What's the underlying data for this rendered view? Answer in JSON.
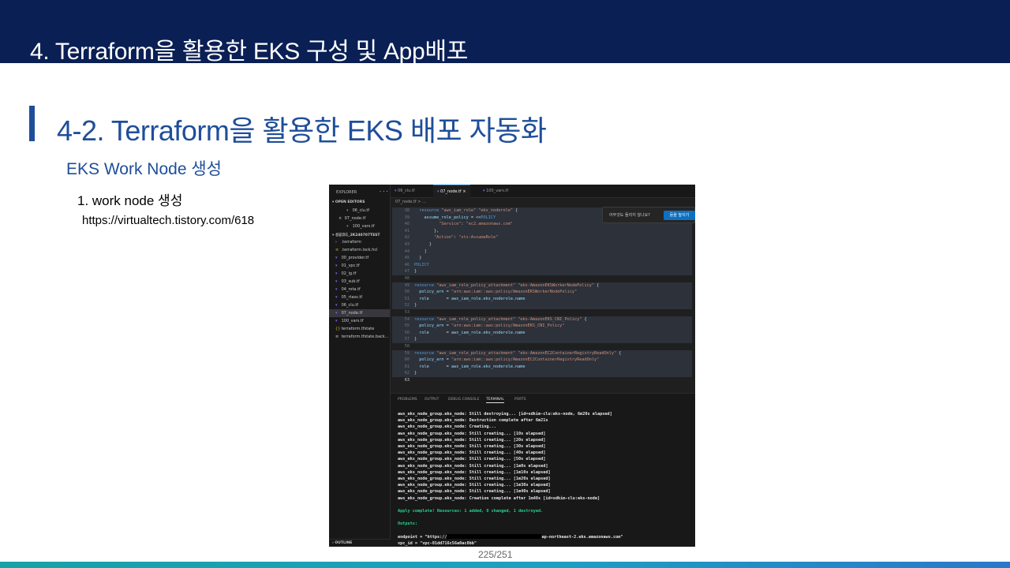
{
  "header": {
    "title": "4. Terraform을 활용한 EKS 구성 및 App배포"
  },
  "section": {
    "title": "4-2. Terraform을 활용한 EKS 배포 자동화",
    "subtitle": "EKS Work Node 생성",
    "step": "1. work node 생성",
    "url": "https://virtualtech.tistory.com/618"
  },
  "footer": {
    "page": "225/251"
  },
  "colors": {
    "header_band": "#0a1f54",
    "accent_blue": "#1f4e9a",
    "bottom_band_start": "#15a3a6",
    "bottom_band_end": "#2b78c9"
  },
  "ide": {
    "explorer": {
      "title": "EXPLORER",
      "more": "···",
      "open_editors_label": "OPEN EDITORS",
      "open_editors": [
        {
          "icon": "terraform-icon",
          "name": "06_clu.tf"
        },
        {
          "icon": "close-icon",
          "name": "07_node.tf"
        },
        {
          "icon": "terraform-icon",
          "name": "100_vars.tf"
        }
      ],
      "project_label": "성공코드_2K240707TEST",
      "files": [
        {
          "icon": "chevron-right-icon",
          "name": ".terraform"
        },
        {
          "icon": "lock-icon",
          "name": ".terraform.lock.hcl"
        },
        {
          "icon": "terraform-icon",
          "name": "00_provider.tf"
        },
        {
          "icon": "terraform-icon",
          "name": "01_vpc.tf"
        },
        {
          "icon": "terraform-icon",
          "name": "02_ig.tf"
        },
        {
          "icon": "terraform-icon",
          "name": "03_sub.tf"
        },
        {
          "icon": "terraform-icon",
          "name": "04_rota.tf"
        },
        {
          "icon": "terraform-icon",
          "name": "05_rtass.tf"
        },
        {
          "icon": "terraform-icon",
          "name": "06_clu.tf"
        },
        {
          "icon": "terraform-icon",
          "name": "07_node.tf"
        },
        {
          "icon": "terraform-icon",
          "name": "100_vars.tf"
        },
        {
          "icon": "braces-icon",
          "name": "terraform.tfstate"
        },
        {
          "icon": "state-icon",
          "name": "terraform.tfstate.back..."
        }
      ],
      "active_file": "07_node.tf",
      "outline_label": "OUTLINE"
    },
    "tabs": [
      {
        "name": "06_clu.tf",
        "active": false
      },
      {
        "name": "07_node.tf",
        "active": true,
        "close": "×"
      },
      {
        "name": "100_vars.tf",
        "active": false
      }
    ],
    "breadcrumb": "07_node.tf > ...",
    "popup": {
      "text": "아무것도 들리지 않나요?",
      "button": "듣을 높이기"
    },
    "code_lines": [
      {
        "n": "38",
        "t": "  resource \"aws_iam_role\" \"eks_noderole\" {",
        "hl": true
      },
      {
        "n": "39",
        "t": "    assume_role_policy = <<POLICY",
        "hl": true
      },
      {
        "n": "40",
        "t": "          \"Service\": \"ec2.amazonaws.com\"",
        "hl": true
      },
      {
        "n": "41",
        "t": "        },",
        "hl": true
      },
      {
        "n": "42",
        "t": "        \"Action\": \"sts:AssumeRole\"",
        "hl": true
      },
      {
        "n": "43",
        "t": "      }",
        "hl": true
      },
      {
        "n": "44",
        "t": "    ]",
        "hl": true
      },
      {
        "n": "45",
        "t": "  }",
        "hl": true
      },
      {
        "n": "46",
        "t": "POLICY",
        "hl": true
      },
      {
        "n": "47",
        "t": "}",
        "hl": true
      },
      {
        "n": "48",
        "t": "",
        "hl": false
      },
      {
        "n": "49",
        "t": "resource \"aws_iam_role_policy_attachment\" \"eks-AmazonEKSWorkerNodePolicy\" {",
        "hl": true
      },
      {
        "n": "50",
        "t": "  policy_arn = \"arn:aws:iam::aws:policy/AmazonEKSWorkerNodePolicy\"",
        "hl": true
      },
      {
        "n": "51",
        "t": "  role       = aws_iam_role.eks_noderole.name",
        "hl": true
      },
      {
        "n": "52",
        "t": "}",
        "hl": true
      },
      {
        "n": "53",
        "t": "",
        "hl": false
      },
      {
        "n": "54",
        "t": "resource \"aws_iam_role_policy_attachment\" \"eks-AmazonEKS_CNI_Policy\" {",
        "hl": true
      },
      {
        "n": "55",
        "t": "  policy_arn = \"arn:aws:iam::aws:policy/AmazonEKS_CNI_Policy\"",
        "hl": true
      },
      {
        "n": "56",
        "t": "  role       = aws_iam_role.eks_noderole.name",
        "hl": true
      },
      {
        "n": "57",
        "t": "}",
        "hl": true
      },
      {
        "n": "58",
        "t": "",
        "hl": false
      },
      {
        "n": "59",
        "t": "resource \"aws_iam_role_policy_attachment\" \"eks-AmazonEC2ContainerRegistryReadOnly\" {",
        "hl": true
      },
      {
        "n": "60",
        "t": "  policy_arn = \"arn:aws:iam::aws:policy/AmazonEC2ContainerRegistryReadOnly\"",
        "hl": true
      },
      {
        "n": "61",
        "t": "  role       = aws_iam_role.eks_noderole.name",
        "hl": true
      },
      {
        "n": "62",
        "t": "}",
        "hl": true
      },
      {
        "n": "63",
        "t": "",
        "hl": false
      }
    ],
    "panel_tabs": [
      {
        "name": "PROBLEMS",
        "active": false
      },
      {
        "name": "OUTPUT",
        "active": false
      },
      {
        "name": "DEBUG CONSOLE",
        "active": false
      },
      {
        "name": "TERMINAL",
        "active": true
      },
      {
        "name": "PORTS",
        "active": false
      }
    ],
    "terminal": [
      {
        "t": "aws_eks_node_group.eks_node: Still destroying... [id=sdkim-clu:eks-node, 6m20s elapsed]",
        "c": "white"
      },
      {
        "t": "aws_eks_node_group.eks_node: Destruction complete after 6m21s",
        "c": "white"
      },
      {
        "t": "aws_eks_node_group.eks_node: Creating...",
        "c": "white"
      },
      {
        "t": "aws_eks_node_group.eks_node: Still creating... [10s elapsed]",
        "c": "white"
      },
      {
        "t": "aws_eks_node_group.eks_node: Still creating... [20s elapsed]",
        "c": "white"
      },
      {
        "t": "aws_eks_node_group.eks_node: Still creating... [30s elapsed]",
        "c": "white"
      },
      {
        "t": "aws_eks_node_group.eks_node: Still creating... [40s elapsed]",
        "c": "white"
      },
      {
        "t": "aws_eks_node_group.eks_node: Still creating... [50s elapsed]",
        "c": "white"
      },
      {
        "t": "aws_eks_node_group.eks_node: Still creating... [1m0s elapsed]",
        "c": "white"
      },
      {
        "t": "aws_eks_node_group.eks_node: Still creating... [1m10s elapsed]",
        "c": "white"
      },
      {
        "t": "aws_eks_node_group.eks_node: Still creating... [1m20s elapsed]",
        "c": "white"
      },
      {
        "t": "aws_eks_node_group.eks_node: Still creating... [1m30s elapsed]",
        "c": "white"
      },
      {
        "t": "aws_eks_node_group.eks_node: Still creating... [1m40s elapsed]",
        "c": "white"
      },
      {
        "t": "aws_eks_node_group.eks_node: Creation complete after 1m48s [id=sdkim-clu:eks-node]",
        "c": "white"
      },
      {
        "t": "",
        "c": "white"
      },
      {
        "t": "Apply complete! Resources: 1 added, 0 changed, 1 destroyed.",
        "c": "green"
      },
      {
        "t": "",
        "c": "white"
      },
      {
        "t": "Outputs:",
        "c": "green"
      },
      {
        "t": "",
        "c": "white"
      }
    ],
    "endpoint_prefix": "endpoint = \"https://",
    "endpoint_suffix": "ap-northeast-2.eks.amazonaws.com\"",
    "vpc_line": "vpc_id = \"vpc-01dd716c56a0ac8bb\""
  }
}
